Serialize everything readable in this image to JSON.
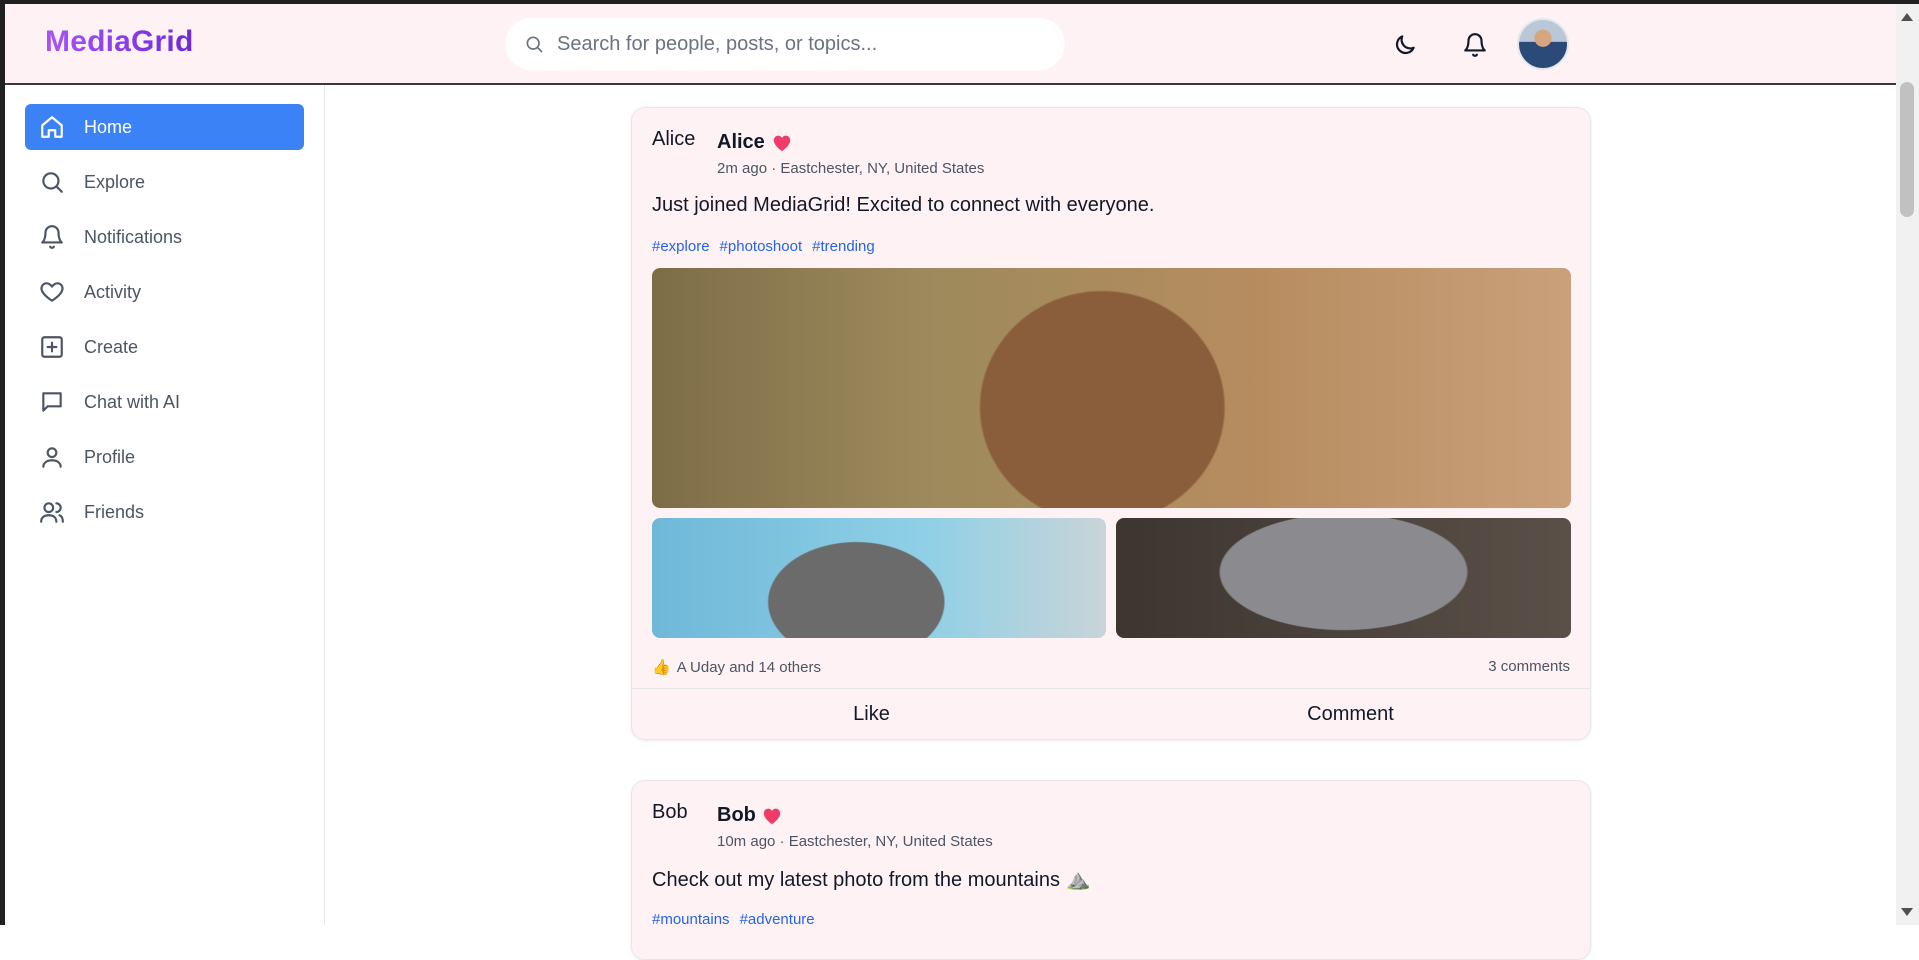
{
  "app": {
    "title": "MediaGrid"
  },
  "search": {
    "placeholder": "Search for people, posts, or topics..."
  },
  "header": {
    "theme_icon": "moon-icon",
    "notify_icon": "bell-icon"
  },
  "sidebar": {
    "items": [
      {
        "label": "Home",
        "icon": "home-icon",
        "active": true
      },
      {
        "label": "Explore",
        "icon": "search-icon"
      },
      {
        "label": "Notifications",
        "icon": "bell-icon"
      },
      {
        "label": "Activity",
        "icon": "heart-icon"
      },
      {
        "label": "Create",
        "icon": "plus-square-icon"
      },
      {
        "label": "Chat with AI",
        "icon": "chat-icon"
      },
      {
        "label": "Profile",
        "icon": "user-icon"
      },
      {
        "label": "Friends",
        "icon": "users-icon"
      }
    ]
  },
  "posts": [
    {
      "avatar_alt": "Alice",
      "author": "Alice",
      "meta": "2m ago · Eastchester, NY, United States",
      "text": "Just joined MediaGrid! Excited to connect with everyone.",
      "tags": [
        "#explore",
        "#photoshoot",
        "#trending"
      ],
      "reaction_emoji": "👍",
      "likes": "A Uday and 14 others",
      "comments": "3 comments",
      "like_label": "Like",
      "comment_label": "Comment"
    },
    {
      "avatar_alt": "Bob",
      "author": "Bob",
      "meta": "10m ago · Eastchester, NY, United States",
      "text": "Check out my latest photo from the mountains ⛰️",
      "tags": [
        "#mountains",
        "#adventure"
      ]
    }
  ],
  "colors": {
    "accent": "#3b82f6",
    "brand_start": "#a855f7",
    "brand_end": "#6d28d9",
    "tag": "#2563eb",
    "card_bg": "#fff2f5",
    "heart": "#ef3b6a"
  }
}
